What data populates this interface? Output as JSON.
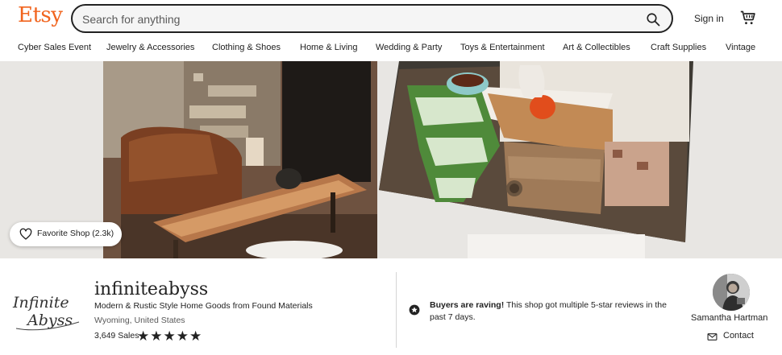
{
  "header": {
    "logo_text": "Etsy",
    "search_placeholder": "Search for anything",
    "signin_label": "Sign in",
    "icons": {
      "search": "search-icon",
      "cart": "cart-icon"
    }
  },
  "nav": {
    "items": [
      "Cyber Sales Event",
      "Jewelry & Accessories",
      "Clothing & Shoes",
      "Home & Living",
      "Wedding & Party",
      "Toys & Entertainment",
      "Art & Collectibles",
      "Craft Supplies",
      "Vintage"
    ]
  },
  "banner": {
    "favorite_label": "Favorite Shop (2.3k)",
    "favorite_icon": "heart-icon"
  },
  "shop": {
    "logo_text_1": "Infinite",
    "logo_text_2": "Abyss",
    "name": "infiniteabyss",
    "tagline": "Modern & Rustic Style Home Goods from Found Materials",
    "location": "Wyoming, United States",
    "sales": "3,649 Sales",
    "rating": 5,
    "rating_max": 5
  },
  "raving": {
    "title": "Buyers are raving!",
    "text": " This shop got multiple 5-star reviews in the past 7 days.",
    "icon": "star-badge-icon"
  },
  "owner": {
    "name": "Samantha Hartman",
    "contact_label": "Contact",
    "contact_icon": "mail-icon"
  },
  "colors": {
    "brand": "#F1641E",
    "text": "#222222"
  }
}
